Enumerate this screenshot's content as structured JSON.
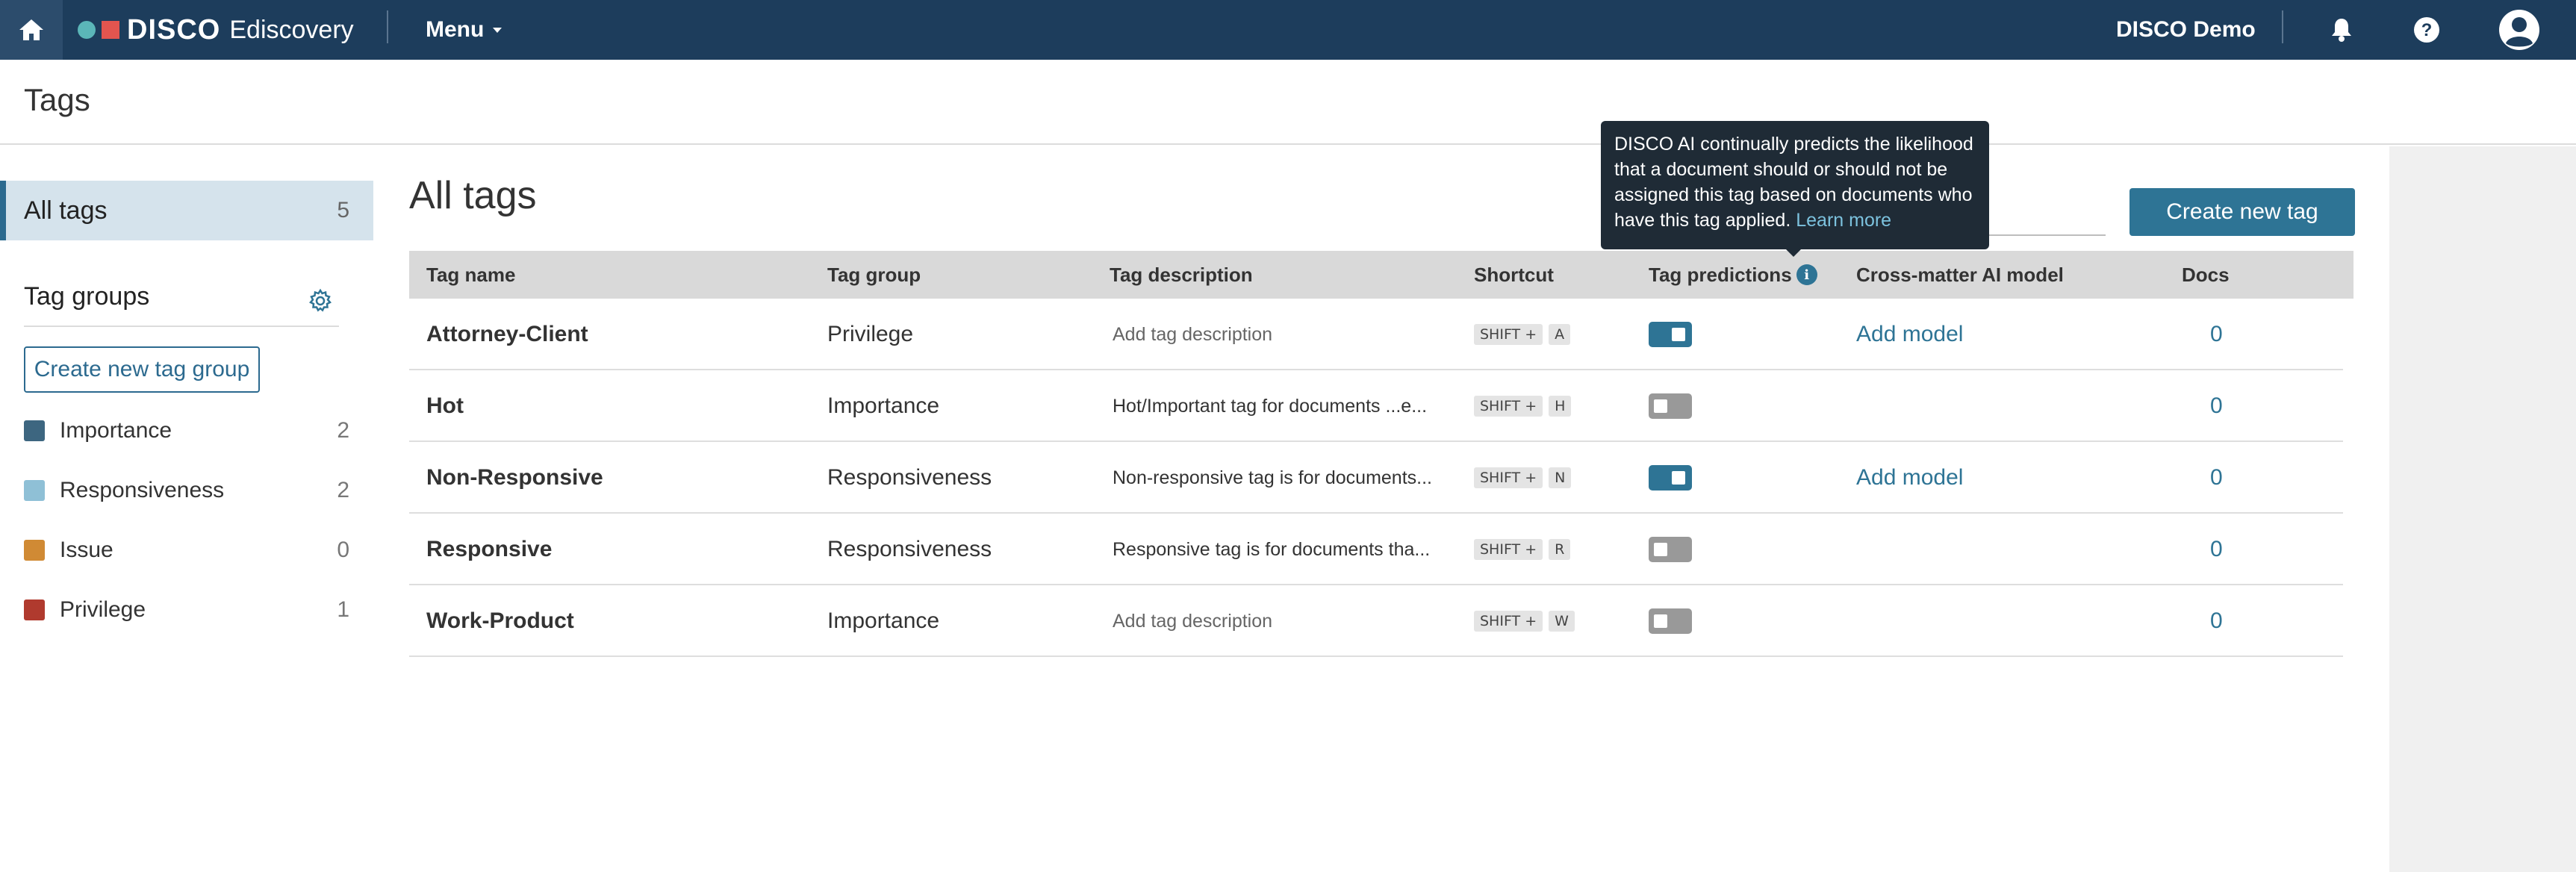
{
  "app": {
    "logo_text": "DISCO",
    "logo_sub": "Ediscovery",
    "menu_label": "Menu",
    "org_name": "DISCO Demo",
    "brand_colors": {
      "navbar": "#1d3d5c",
      "accent": "#2e7495"
    }
  },
  "page": {
    "title": "Tags"
  },
  "sidebar": {
    "all_tags": {
      "label": "All tags",
      "count": "5"
    },
    "tag_groups_title": "Tag groups",
    "create_group_label": "Create new tag group",
    "groups": [
      {
        "name": "Importance",
        "count": "2",
        "color": "#3d6680"
      },
      {
        "name": "Responsiveness",
        "count": "2",
        "color": "#8fc0d6"
      },
      {
        "name": "Issue",
        "count": "0",
        "color": "#d08a34"
      },
      {
        "name": "Privilege",
        "count": "1",
        "color": "#b03a2e"
      }
    ]
  },
  "main": {
    "title": "All tags",
    "create_tag_label": "Create new tag",
    "columns": {
      "name": "Tag name",
      "group": "Tag group",
      "description": "Tag description",
      "shortcut": "Shortcut",
      "predictions": "Tag predictions",
      "ai_model": "Cross-matter AI model",
      "docs": "Docs"
    },
    "shortcut_prefix": "SHIFT +",
    "rows": [
      {
        "name": "Attorney-Client",
        "group": "Privilege",
        "description": "Add tag description",
        "description_placeholder": true,
        "key": "A",
        "predictions_on": true,
        "ai_model": "Add model",
        "docs": "0"
      },
      {
        "name": "Hot",
        "group": "Importance",
        "description": "Hot/Important tag for documents ...e...",
        "description_placeholder": false,
        "key": "H",
        "predictions_on": false,
        "ai_model": "",
        "docs": "0"
      },
      {
        "name": "Non-Responsive",
        "group": "Responsiveness",
        "description": "Non-responsive tag is for documents...",
        "description_placeholder": false,
        "key": "N",
        "predictions_on": true,
        "ai_model": "Add model",
        "docs": "0"
      },
      {
        "name": "Responsive",
        "group": "Responsiveness",
        "description": "Responsive tag is for documents tha...",
        "description_placeholder": false,
        "key": "R",
        "predictions_on": false,
        "ai_model": "",
        "docs": "0"
      },
      {
        "name": "Work-Product",
        "group": "Importance",
        "description": "Add tag description",
        "description_placeholder": true,
        "key": "W",
        "predictions_on": false,
        "ai_model": "",
        "docs": "0"
      }
    ]
  },
  "tooltip": {
    "text": "DISCO AI continually predicts the likelihood that a document should or should not be assigned this tag based on documents who have this tag applied.",
    "link": "Learn more"
  }
}
